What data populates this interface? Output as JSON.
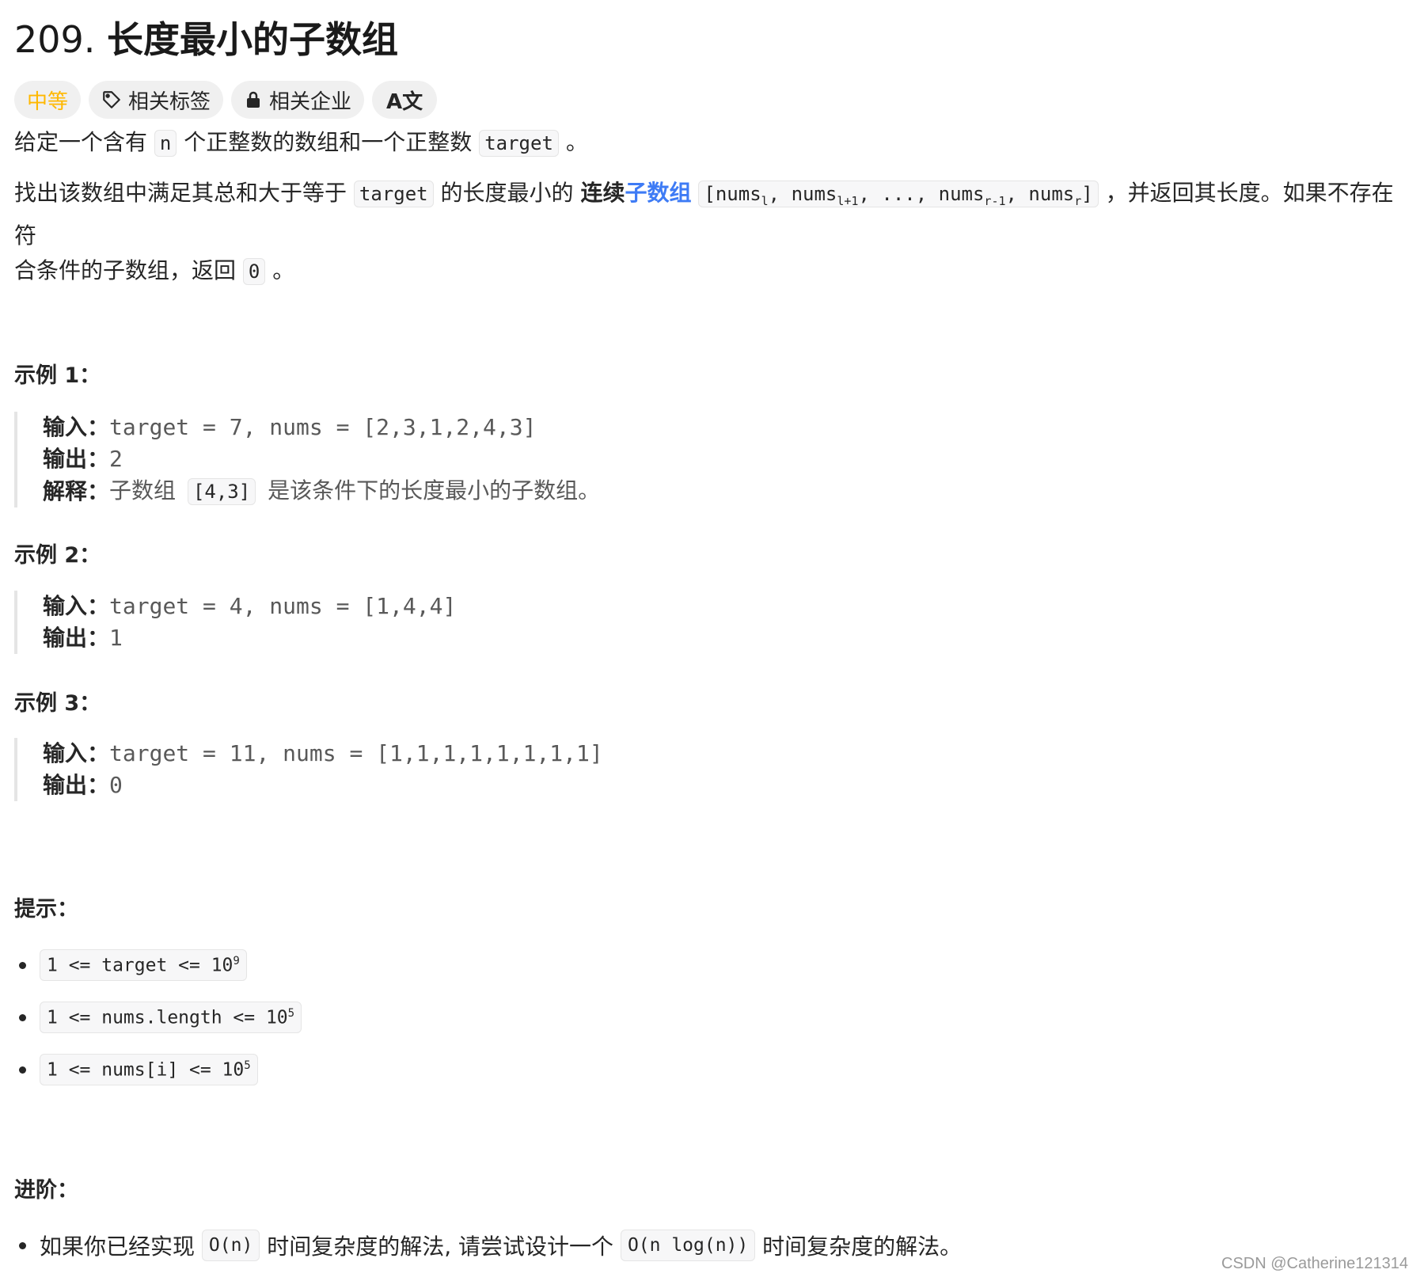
{
  "problem": {
    "number": "209.",
    "title": "长度最小的子数组"
  },
  "tags": {
    "difficulty": "中等",
    "related_tags": "相关标签",
    "related_companies": "相关企业",
    "translate_icon": "A文"
  },
  "description": {
    "p1_a": "给定一个含有",
    "p1_code_n": "n",
    "p1_b": "个正整数的数组和一个正整数",
    "p1_code_target": "target",
    "p1_c": "。",
    "p2_a": "找出该数组中满足其总和大于等于",
    "p2_code_target": "target",
    "p2_b": "的长度最小的",
    "p2_bold": "连续",
    "p2_link": "子数组",
    "p2_code_1": "[nums",
    "p2_sub_1": "l",
    "p2_code_2": ", nums",
    "p2_sub_2": "l+1",
    "p2_code_3": ", ..., nums",
    "p2_sub_3": "r-1",
    "p2_code_4": ", nums",
    "p2_sub_4": "r",
    "p2_code_5": "]",
    "p2_c": "，并返回其长度。如果不存在符",
    "p2_d": "合条件的子数组，返回",
    "p2_code_0": "0",
    "p2_e": "。"
  },
  "examples": [
    {
      "heading": "示例 1：",
      "input_label": "输入：",
      "input": "target = 7, nums = [2,3,1,2,4,3]",
      "output_label": "输出：",
      "output": "2",
      "explain_label": "解释：",
      "explain_a": "子数组",
      "explain_code": "[4,3]",
      "explain_b": "是该条件下的长度最小的子数组。"
    },
    {
      "heading": "示例 2：",
      "input_label": "输入：",
      "input": "target = 4, nums = [1,4,4]",
      "output_label": "输出：",
      "output": "1"
    },
    {
      "heading": "示例 3：",
      "input_label": "输入：",
      "input": "target = 11, nums = [1,1,1,1,1,1,1,1]",
      "output_label": "输出：",
      "output": "0"
    }
  ],
  "constraints": {
    "heading": "提示：",
    "items": [
      {
        "text": "1 <= target <= 10",
        "sup": "9"
      },
      {
        "text": "1 <= nums.length <= 10",
        "sup": "5"
      },
      {
        "text": "1 <= nums[i] <= 10",
        "sup": "5"
      }
    ]
  },
  "followup": {
    "heading": "进阶：",
    "a": "如果你已经实现",
    "code1": "O(n)",
    "b": "时间复杂度的解法, 请尝试设计一个",
    "code2": "O(n log(n))",
    "c": "时间复杂度的解法。"
  },
  "watermark": "CSDN @Catherine121314"
}
